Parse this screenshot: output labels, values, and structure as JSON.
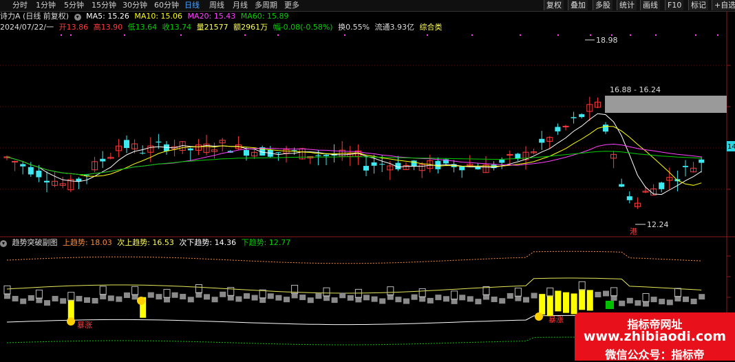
{
  "toolbar": {
    "periods": [
      "分时",
      "1分钟",
      "5分钟",
      "15分钟",
      "30分钟",
      "60分钟",
      "日线",
      "周线",
      "月线",
      "多周期",
      "更多"
    ],
    "active_period": "日线",
    "buttons": [
      "复权",
      "叠加",
      "多股",
      "统计",
      "画线",
      "F10",
      "标记",
      "+自选"
    ]
  },
  "main_header": {
    "stock_name": "诗力A (日线 前复权)",
    "ma5": "MA5: 15.26",
    "ma10": "MA10: 15.06",
    "ma20": "MA20: 15.43",
    "ma60": "MA60: 15.89"
  },
  "quote_bar": {
    "date": "2024/07/22/一",
    "open": "开13.86",
    "high": "高13.90",
    "low": "低13.64",
    "close": "收13.74",
    "volume": "量21577",
    "amount": "额2961万",
    "change": "幅-0.08(-0.58%)",
    "turnover": "换0.55%",
    "float_cap": "流通3.93亿",
    "category": "综合类"
  },
  "annotations": {
    "high_label": "18.98",
    "range_label": "16.88 - 16.24",
    "low_label": "12.24",
    "low_marker": "港",
    "price_tag": "14"
  },
  "sub_header": {
    "name": "趋势突破副图",
    "up": "上趋势: 18.03",
    "next_up": "次上趋势: 16.53",
    "next_down": "次下趋势: 14.36",
    "down": "下趋势: 12.77"
  },
  "sub_markers": {
    "signal_text": "暴涨"
  },
  "watermark": {
    "line1": "指标帝网址",
    "line2": "www.zhibiaodi.com",
    "line3": "微信公众号：指标帝"
  },
  "colors": {
    "up": "#ff3b3b",
    "down": "#3de8f0",
    "ma5": "#ffffff",
    "ma10": "#ffff00",
    "ma20": "#ff40ff",
    "ma60": "#00d000",
    "active_tab": "#4aa3ff",
    "signal_bar": "#ffff00"
  }
}
